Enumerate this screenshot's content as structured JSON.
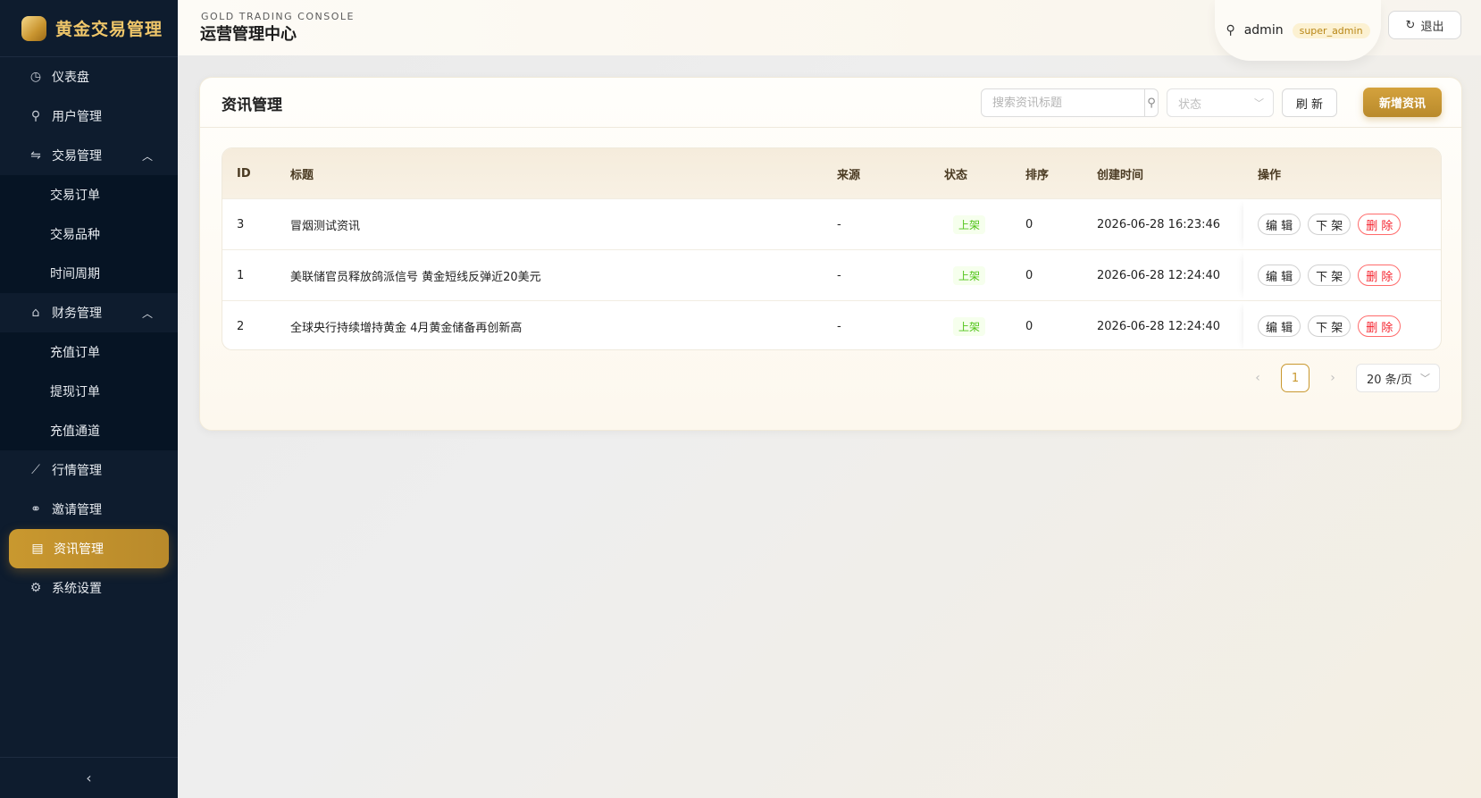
{
  "brand": {
    "title": "黄金交易管理"
  },
  "sidebar": {
    "items": [
      {
        "label": "仪表盘",
        "icon": "dashboard-icon"
      },
      {
        "label": "用户管理",
        "icon": "user-icon"
      },
      {
        "label": "交易管理",
        "icon": "swap-icon",
        "expanded": true,
        "children": [
          "交易订单",
          "交易品种",
          "时间周期"
        ]
      },
      {
        "label": "财务管理",
        "icon": "bank-icon",
        "expanded": true,
        "children": [
          "充值订单",
          "提现订单",
          "充值通道"
        ]
      },
      {
        "label": "行情管理",
        "icon": "chart-line-icon"
      },
      {
        "label": "邀请管理",
        "icon": "invite-icon"
      },
      {
        "label": "资讯管理",
        "icon": "file-icon",
        "active": true
      },
      {
        "label": "系统设置",
        "icon": "gear-icon"
      }
    ]
  },
  "header": {
    "subtitle": "GOLD TRADING CONSOLE",
    "title": "运营管理中心",
    "user": {
      "name": "admin",
      "role": "super_admin"
    },
    "logout_label": "退出"
  },
  "card": {
    "title": "资讯管理",
    "search": {
      "placeholder": "搜索资讯标题",
      "value": ""
    },
    "status_select": {
      "placeholder": "状态"
    },
    "refresh_label": "刷 新",
    "add_label": "新增资讯"
  },
  "table": {
    "columns": [
      "ID",
      "标题",
      "来源",
      "状态",
      "排序",
      "创建时间",
      "操作"
    ],
    "rows": [
      {
        "id": "3",
        "title": "冒烟测试资讯",
        "source": "-",
        "status": "上架",
        "sort": "0",
        "created": "2026-06-28 16:23:46"
      },
      {
        "id": "1",
        "title": "美联储官员释放鸽派信号 黄金短线反弹近20美元",
        "source": "-",
        "status": "上架",
        "sort": "0",
        "created": "2026-06-28 12:24:40"
      },
      {
        "id": "2",
        "title": "全球央行持续增持黄金 4月黄金储备再创新高",
        "source": "-",
        "status": "上架",
        "sort": "0",
        "created": "2026-06-28 12:24:40"
      }
    ],
    "ops": {
      "edit": "编 辑",
      "offline": "下 架",
      "delete": "删 除"
    }
  },
  "pagination": {
    "current": "1",
    "page_size": "20 条/页"
  },
  "colors": {
    "accent": "#c9982f",
    "sidebar_bg": "#0e1c2e",
    "status_green": "#52c41a",
    "danger": "#f5222d"
  }
}
